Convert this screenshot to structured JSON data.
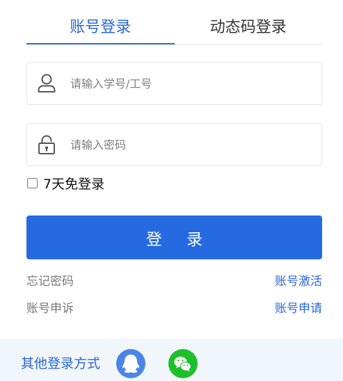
{
  "tabs": {
    "account_login": "账号登录",
    "dynamic_code_login": "动态码登录"
  },
  "form": {
    "username_placeholder": "请输入学号/工号",
    "username_value": "",
    "password_placeholder": "请输入密码",
    "password_value": "",
    "remember_label": "7天免登录",
    "remember_checked": false,
    "login_button": "登 录"
  },
  "links": {
    "forgot_password": "忘记密码",
    "activate_account": "账号激活",
    "account_appeal": "账号申诉",
    "account_apply": "账号申请"
  },
  "other_login": {
    "label": "其他登录方式",
    "methods": [
      "qq-icon",
      "wechat-icon"
    ]
  },
  "colors": {
    "accent": "#2a67d8",
    "button": "#266ae1",
    "qq": "#4a86e6",
    "wechat": "#1ec02a",
    "footer_bg": "#f1f6fd"
  }
}
